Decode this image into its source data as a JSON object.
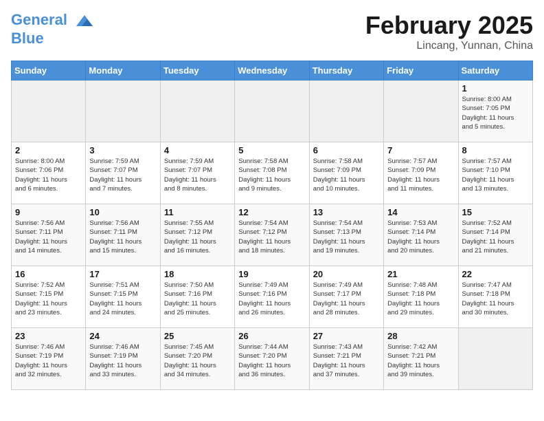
{
  "header": {
    "logo_line1": "General",
    "logo_line2": "Blue",
    "month": "February 2025",
    "location": "Lincang, Yunnan, China"
  },
  "weekdays": [
    "Sunday",
    "Monday",
    "Tuesday",
    "Wednesday",
    "Thursday",
    "Friday",
    "Saturday"
  ],
  "weeks": [
    [
      {
        "day": "",
        "info": ""
      },
      {
        "day": "",
        "info": ""
      },
      {
        "day": "",
        "info": ""
      },
      {
        "day": "",
        "info": ""
      },
      {
        "day": "",
        "info": ""
      },
      {
        "day": "",
        "info": ""
      },
      {
        "day": "1",
        "info": "Sunrise: 8:00 AM\nSunset: 7:05 PM\nDaylight: 11 hours\nand 5 minutes."
      }
    ],
    [
      {
        "day": "2",
        "info": "Sunrise: 8:00 AM\nSunset: 7:06 PM\nDaylight: 11 hours\nand 6 minutes."
      },
      {
        "day": "3",
        "info": "Sunrise: 7:59 AM\nSunset: 7:07 PM\nDaylight: 11 hours\nand 7 minutes."
      },
      {
        "day": "4",
        "info": "Sunrise: 7:59 AM\nSunset: 7:07 PM\nDaylight: 11 hours\nand 8 minutes."
      },
      {
        "day": "5",
        "info": "Sunrise: 7:58 AM\nSunset: 7:08 PM\nDaylight: 11 hours\nand 9 minutes."
      },
      {
        "day": "6",
        "info": "Sunrise: 7:58 AM\nSunset: 7:09 PM\nDaylight: 11 hours\nand 10 minutes."
      },
      {
        "day": "7",
        "info": "Sunrise: 7:57 AM\nSunset: 7:09 PM\nDaylight: 11 hours\nand 11 minutes."
      },
      {
        "day": "8",
        "info": "Sunrise: 7:57 AM\nSunset: 7:10 PM\nDaylight: 11 hours\nand 13 minutes."
      }
    ],
    [
      {
        "day": "9",
        "info": "Sunrise: 7:56 AM\nSunset: 7:11 PM\nDaylight: 11 hours\nand 14 minutes."
      },
      {
        "day": "10",
        "info": "Sunrise: 7:56 AM\nSunset: 7:11 PM\nDaylight: 11 hours\nand 15 minutes."
      },
      {
        "day": "11",
        "info": "Sunrise: 7:55 AM\nSunset: 7:12 PM\nDaylight: 11 hours\nand 16 minutes."
      },
      {
        "day": "12",
        "info": "Sunrise: 7:54 AM\nSunset: 7:12 PM\nDaylight: 11 hours\nand 18 minutes."
      },
      {
        "day": "13",
        "info": "Sunrise: 7:54 AM\nSunset: 7:13 PM\nDaylight: 11 hours\nand 19 minutes."
      },
      {
        "day": "14",
        "info": "Sunrise: 7:53 AM\nSunset: 7:14 PM\nDaylight: 11 hours\nand 20 minutes."
      },
      {
        "day": "15",
        "info": "Sunrise: 7:52 AM\nSunset: 7:14 PM\nDaylight: 11 hours\nand 21 minutes."
      }
    ],
    [
      {
        "day": "16",
        "info": "Sunrise: 7:52 AM\nSunset: 7:15 PM\nDaylight: 11 hours\nand 23 minutes."
      },
      {
        "day": "17",
        "info": "Sunrise: 7:51 AM\nSunset: 7:15 PM\nDaylight: 11 hours\nand 24 minutes."
      },
      {
        "day": "18",
        "info": "Sunrise: 7:50 AM\nSunset: 7:16 PM\nDaylight: 11 hours\nand 25 minutes."
      },
      {
        "day": "19",
        "info": "Sunrise: 7:49 AM\nSunset: 7:16 PM\nDaylight: 11 hours\nand 26 minutes."
      },
      {
        "day": "20",
        "info": "Sunrise: 7:49 AM\nSunset: 7:17 PM\nDaylight: 11 hours\nand 28 minutes."
      },
      {
        "day": "21",
        "info": "Sunrise: 7:48 AM\nSunset: 7:18 PM\nDaylight: 11 hours\nand 29 minutes."
      },
      {
        "day": "22",
        "info": "Sunrise: 7:47 AM\nSunset: 7:18 PM\nDaylight: 11 hours\nand 30 minutes."
      }
    ],
    [
      {
        "day": "23",
        "info": "Sunrise: 7:46 AM\nSunset: 7:19 PM\nDaylight: 11 hours\nand 32 minutes."
      },
      {
        "day": "24",
        "info": "Sunrise: 7:46 AM\nSunset: 7:19 PM\nDaylight: 11 hours\nand 33 minutes."
      },
      {
        "day": "25",
        "info": "Sunrise: 7:45 AM\nSunset: 7:20 PM\nDaylight: 11 hours\nand 34 minutes."
      },
      {
        "day": "26",
        "info": "Sunrise: 7:44 AM\nSunset: 7:20 PM\nDaylight: 11 hours\nand 36 minutes."
      },
      {
        "day": "27",
        "info": "Sunrise: 7:43 AM\nSunset: 7:21 PM\nDaylight: 11 hours\nand 37 minutes."
      },
      {
        "day": "28",
        "info": "Sunrise: 7:42 AM\nSunset: 7:21 PM\nDaylight: 11 hours\nand 39 minutes."
      },
      {
        "day": "",
        "info": ""
      }
    ]
  ]
}
